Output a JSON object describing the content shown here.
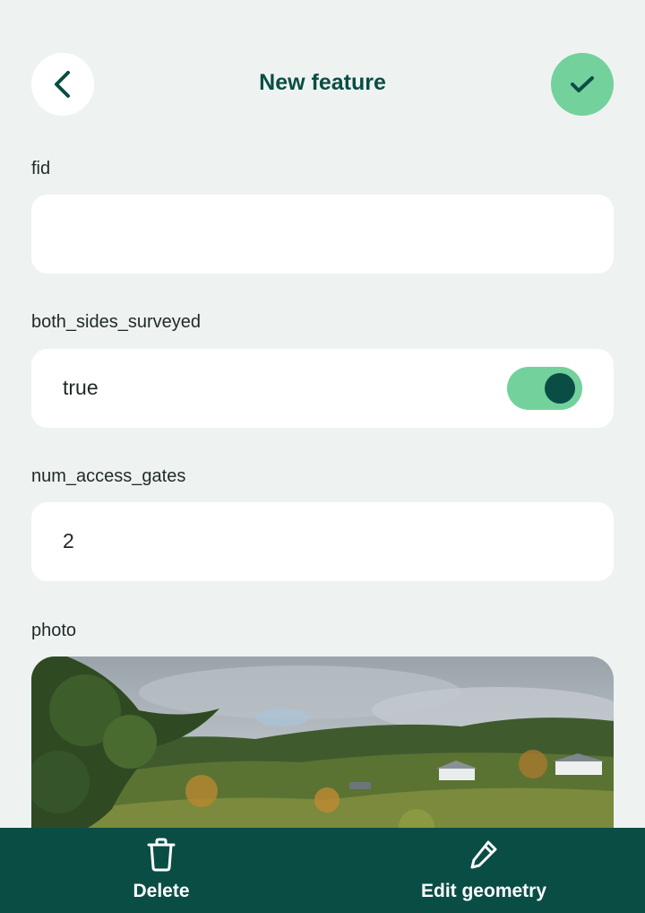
{
  "header": {
    "title": "New feature",
    "back_icon": "chevron-left-icon",
    "confirm_icon": "checkmark-icon"
  },
  "fields": [
    {
      "label": "fid",
      "value": ""
    },
    {
      "label": "both_sides_surveyed",
      "value": "true",
      "toggle_on": true
    },
    {
      "label": "num_access_gates",
      "value": "2"
    },
    {
      "label": "photo"
    }
  ],
  "bottom_bar": {
    "delete_label": "Delete",
    "delete_icon": "trash-icon",
    "edit_geometry_label": "Edit geometry",
    "edit_geometry_icon": "pencil-icon"
  },
  "colors": {
    "background": "#eef3f1",
    "primary_dark": "#0a4d45",
    "accent_green": "#73d19c",
    "field_bg": "#ffffff"
  }
}
